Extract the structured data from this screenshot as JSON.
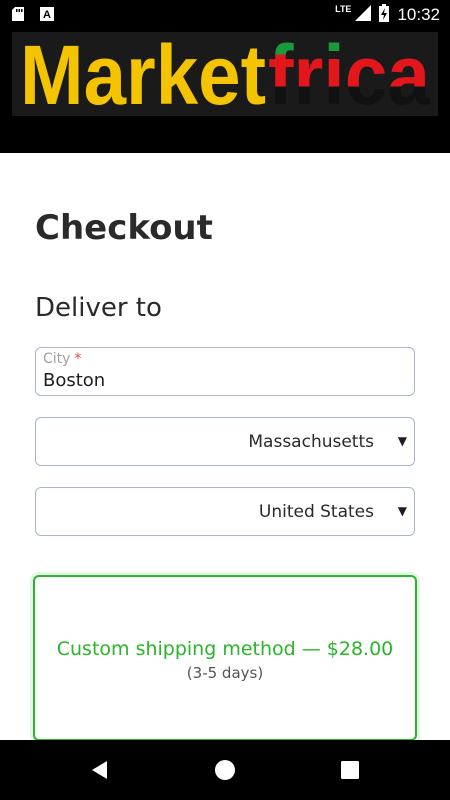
{
  "status_bar": {
    "time": "10:32",
    "network": "LTE",
    "icons": [
      "sd-card-icon",
      "text-a-icon",
      "signal-icon",
      "battery-charging-icon"
    ]
  },
  "header": {
    "logo": {
      "part1": "Market",
      "part2": "frica"
    }
  },
  "checkout": {
    "title": "Checkout",
    "deliver_to": "Deliver to",
    "city": {
      "label": "City",
      "required_mark": "*",
      "value": "Boston"
    },
    "state": {
      "value": "Massachusetts"
    },
    "country": {
      "value": "United States"
    },
    "shipping_option": {
      "title": "Custom shipping method — $28.00",
      "subtitle": "(3-5 days)"
    }
  },
  "colors": {
    "accent_green": "#2ab52a",
    "required_red": "#e64a3c",
    "logo_yellow": "#f5c400",
    "logo_red": "#e3161c",
    "logo_green": "#1a9a3a"
  }
}
